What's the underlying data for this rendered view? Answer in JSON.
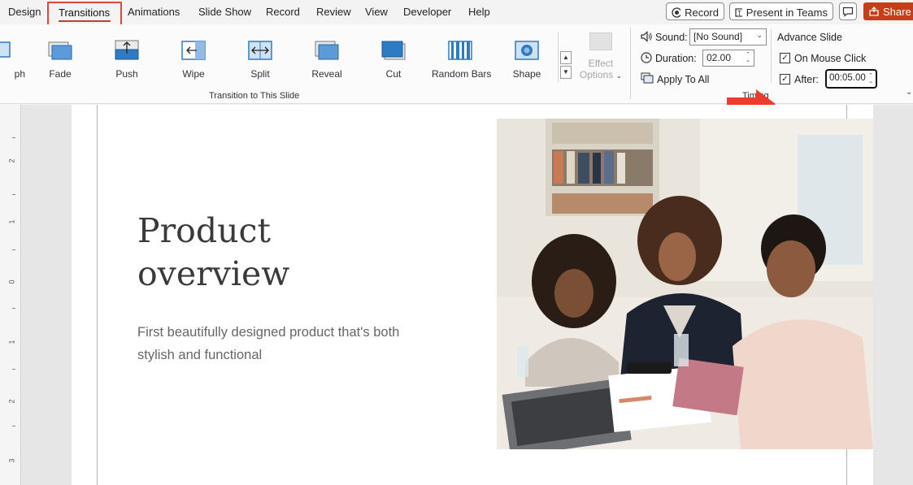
{
  "tabs": {
    "design": "Design",
    "transitions": "Transitions",
    "animations": "Animations",
    "slide_show": "Slide Show",
    "record": "Record",
    "review": "Review",
    "view": "View",
    "developer": "Developer",
    "help": "Help"
  },
  "top_buttons": {
    "record": "Record",
    "present_teams": "Present in Teams",
    "share": "Share"
  },
  "transitions_gallery": {
    "items": [
      {
        "label": "ph",
        "icon": "morph-icon"
      },
      {
        "label": "Fade",
        "icon": "fade-icon"
      },
      {
        "label": "Push",
        "icon": "push-icon"
      },
      {
        "label": "Wipe",
        "icon": "wipe-icon"
      },
      {
        "label": "Split",
        "icon": "split-icon"
      },
      {
        "label": "Reveal",
        "icon": "reveal-icon"
      },
      {
        "label": "Cut",
        "icon": "cut-icon"
      },
      {
        "label": "Random Bars",
        "icon": "random-bars-icon"
      },
      {
        "label": "Shape",
        "icon": "shape-icon"
      }
    ],
    "effect_options_line1": "Effect",
    "effect_options_line2": "Options",
    "group_label": "Transition to This Slide"
  },
  "timing": {
    "sound_label": "Sound:",
    "sound_value": "[No Sound]",
    "duration_label": "Duration:",
    "duration_value": "02.00",
    "apply_to_all": "Apply To All",
    "advance_slide": "Advance Slide",
    "on_mouse_click": "On Mouse Click",
    "on_mouse_click_checked": true,
    "after_label": "After:",
    "after_checked": true,
    "after_value": "00:05.00",
    "group_label": "Timing"
  },
  "ruler_numbers": [
    "2",
    "1",
    "0",
    "1",
    "2",
    "3"
  ],
  "slide": {
    "title_line1": "Product",
    "title_line2": "overview",
    "subtitle": "First beautifully designed product that's both stylish and functional"
  },
  "colors": {
    "accent_red": "#e0443c",
    "share_bg": "#c43e1c",
    "transition_blue": "#2e7bc4",
    "annotation_arrow": "#ee3b2f"
  }
}
